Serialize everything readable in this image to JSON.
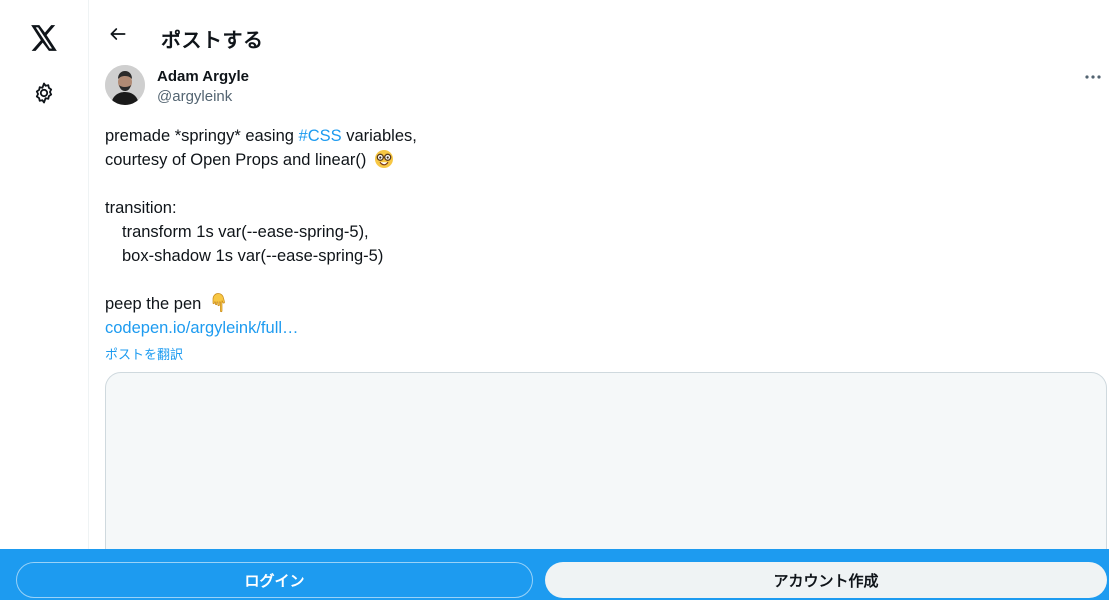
{
  "rail": {
    "logo_icon": "x-logo-icon",
    "settings_icon": "gear-icon"
  },
  "header": {
    "back_icon": "arrow-left-icon",
    "title": "ポストする"
  },
  "post": {
    "author": {
      "name": "Adam Argyle",
      "handle": "@argyleink"
    },
    "more_icon": "more-horizontal-icon",
    "lines": {
      "l1_prefix": "premade *springy* easing ",
      "l1_hashtag": "#CSS",
      "l1_suffix": " variables,",
      "l2": "courtesy of Open Props and linear()",
      "l2_emoji": "nerd-face-emoji",
      "l4": "transition:",
      "l5": "transform 1s var(--ease-spring-5),",
      "l6": "box-shadow 1s var(--ease-spring-5)",
      "l8": "peep the pen",
      "l8_emoji": "pointing-down-emoji",
      "link": "codepen.io/argyleink/full…"
    },
    "translate_label": "ポストを翻訳"
  },
  "bottom_bar": {
    "login_label": "ログイン",
    "signup_label": "アカウント作成"
  },
  "colors": {
    "accent": "#1d9bf0",
    "text": "#0f1419",
    "muted": "#536471",
    "border": "#cfd9de"
  }
}
